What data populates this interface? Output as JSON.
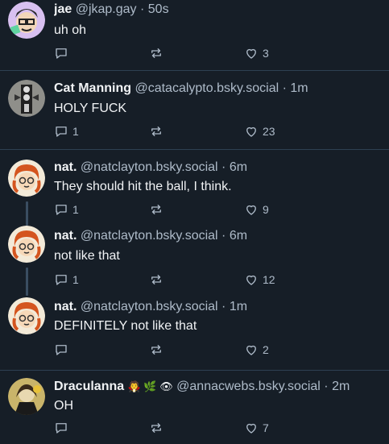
{
  "posts": [
    {
      "name": "jae",
      "handle": "@jkap.gay",
      "time": "50s",
      "text": "uh oh",
      "reply_count": "",
      "like_count": "3",
      "avatar": "avatar-jae"
    },
    {
      "name": "Cat Manning",
      "handle": "@catacalypto.bsky.social",
      "time": "1m",
      "text": "HOLY FUCK",
      "reply_count": "1",
      "like_count": "23",
      "avatar": "avatar-cat"
    },
    {
      "name": "nat.",
      "handle": "@natclayton.bsky.social",
      "time": "6m",
      "text": "They should hit the ball, I think.",
      "reply_count": "1",
      "like_count": "9",
      "avatar": "avatar-nat"
    },
    {
      "name": "nat.",
      "handle": "@natclayton.bsky.social",
      "time": "6m",
      "text": "not like that",
      "reply_count": "1",
      "like_count": "12",
      "avatar": "avatar-nat"
    },
    {
      "name": "nat.",
      "handle": "@natclayton.bsky.social",
      "time": "1m",
      "text": "DEFINITELY not like that",
      "reply_count": "",
      "like_count": "2",
      "avatar": "avatar-nat"
    },
    {
      "name": "Draculanna",
      "name_emoji": "🧛 🌿 👁",
      "handle": "@annacwebs.bsky.social",
      "time": "2m",
      "text": "OH",
      "reply_count": "",
      "like_count": "7",
      "avatar": "avatar-draculanna"
    }
  ],
  "separator": " · ",
  "colors": {
    "background": "#161e27",
    "text": "#f1f3f5",
    "muted": "#aebbc9",
    "border": "#2e4052"
  },
  "icons": {
    "reply": "reply-bubble-icon",
    "repost": "repost-arrows-icon",
    "like": "heart-icon"
  }
}
